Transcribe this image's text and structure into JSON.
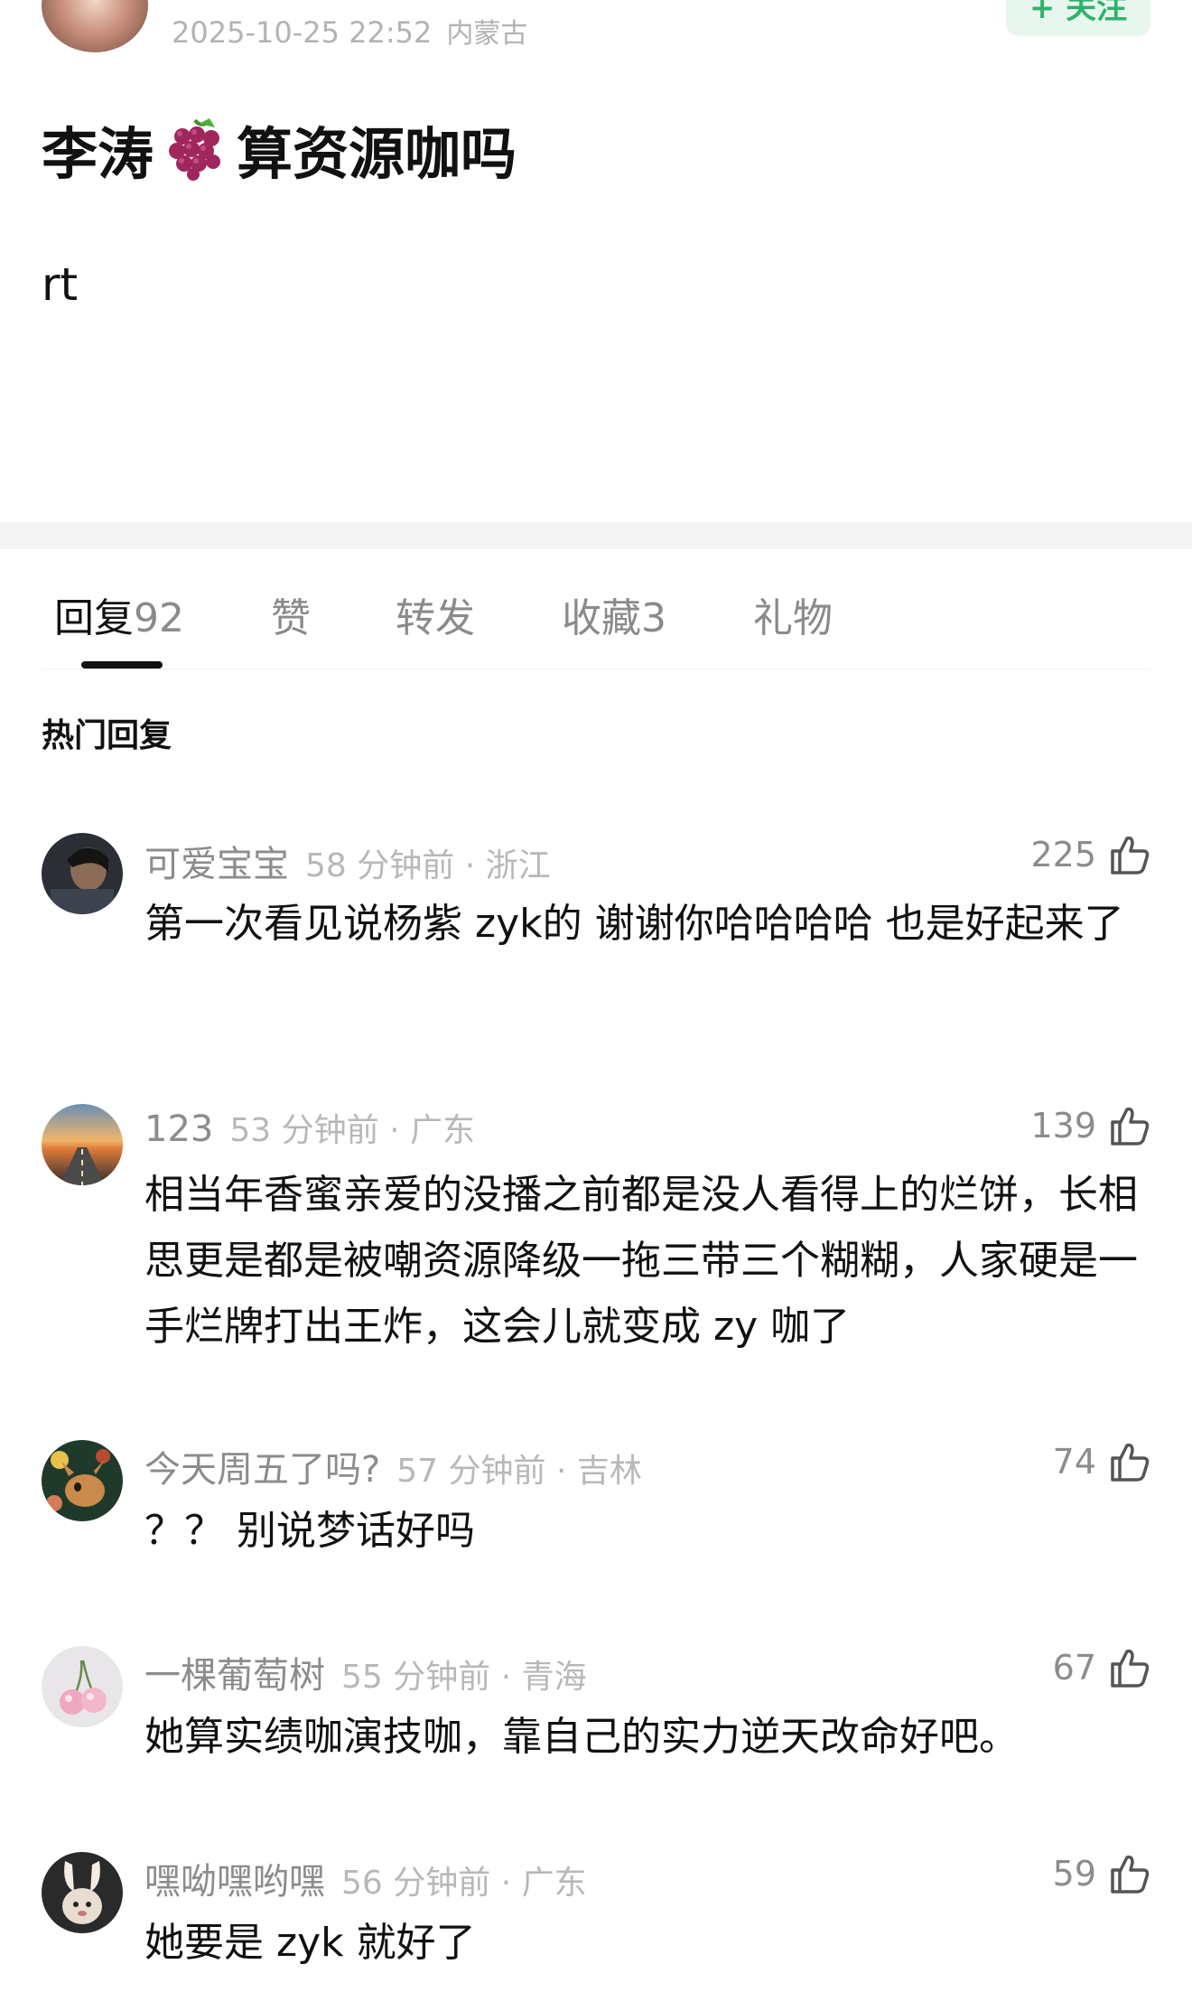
{
  "post": {
    "timestamp": "2025-10-25 22:52",
    "location": "内蒙古",
    "follow_label": "+ 关注",
    "title_before": "李涛",
    "title_after": "算资源咖吗",
    "body": "rt"
  },
  "tabs": [
    {
      "label": "回复",
      "count": "92"
    },
    {
      "label": "赞",
      "count": ""
    },
    {
      "label": "转发",
      "count": ""
    },
    {
      "label": "收藏",
      "count": "3"
    },
    {
      "label": "礼物",
      "count": ""
    }
  ],
  "hot_heading": "热门回复",
  "comments": [
    {
      "name": "可爱宝宝",
      "time": "58 分钟前",
      "loc": "浙江",
      "likes": "225",
      "text": "第一次看见说杨紫 zyk的  谢谢你哈哈哈哈  也是好起来了"
    },
    {
      "name": "123",
      "time": "53 分钟前",
      "loc": "广东",
      "likes": "139",
      "text": "相当年香蜜亲爱的没播之前都是没人看得上的烂饼，长相思更是都是被嘲资源降级一拖三带三个糊糊，人家硬是一手烂牌打出王炸，这会儿就变成 zy 咖了"
    },
    {
      "name": "今天周五了吗?",
      "time": "57 分钟前",
      "loc": "吉林",
      "likes": "74",
      "text": "？？ 别说梦话好吗"
    },
    {
      "name": "一棵葡萄树",
      "time": "55 分钟前",
      "loc": "青海",
      "likes": "67",
      "text": "她算实绩咖演技咖，靠自己的实力逆天改命好吧。"
    },
    {
      "name": "嘿呦嘿哟嘿",
      "time": "56 分钟前",
      "loc": "广东",
      "likes": "59",
      "text": "她要是 zyk 就好了"
    }
  ],
  "colors": {
    "accent_green": "#2fb36b",
    "meta_gray": "#b8b8b8",
    "text_dark": "#111111"
  },
  "icons": {
    "like": "thumbs-up-icon",
    "title_emoji": "grapes-icon"
  }
}
